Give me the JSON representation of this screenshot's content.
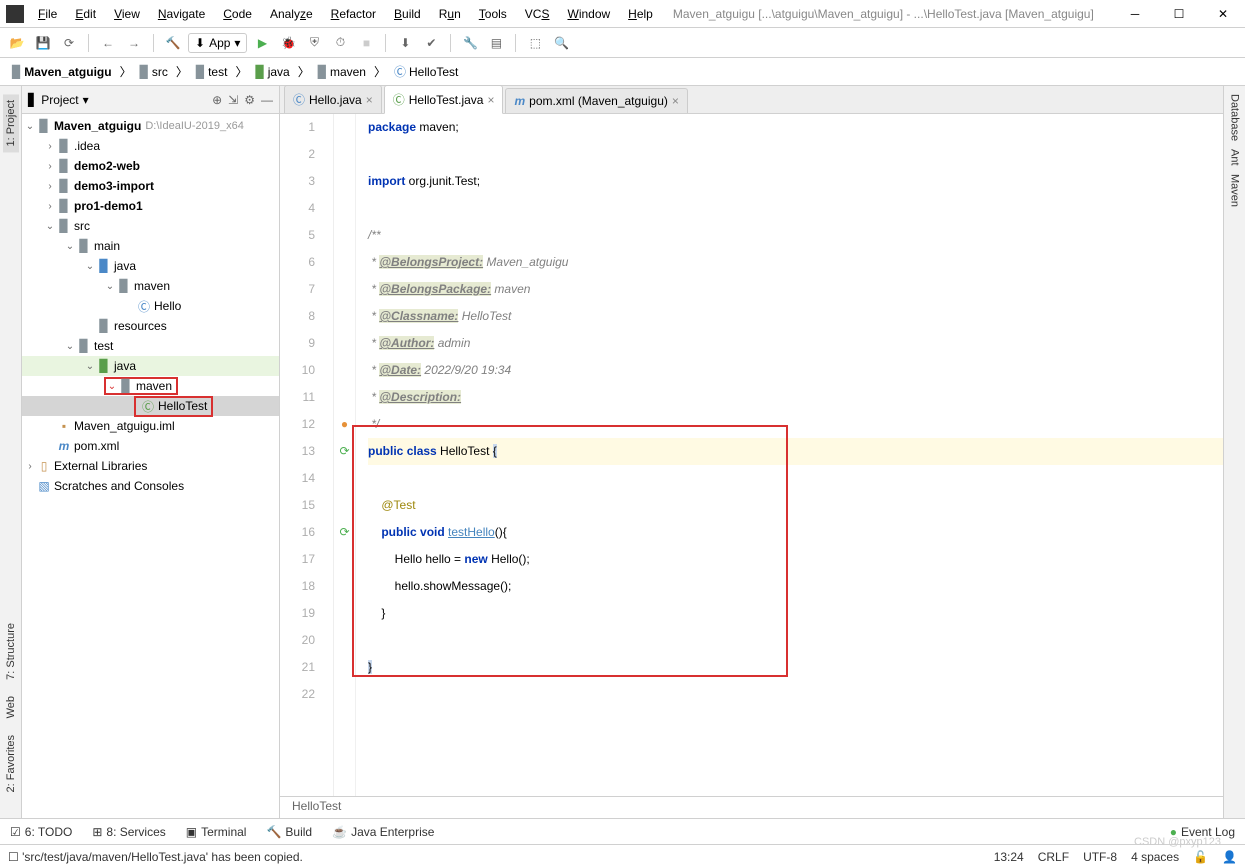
{
  "window": {
    "title": "Maven_atguigu [...\\atguigu\\Maven_atguigu] - ...\\HelloTest.java [Maven_atguigu]"
  },
  "menus": {
    "file": "File",
    "edit": "Edit",
    "view": "View",
    "navigate": "Navigate",
    "code": "Code",
    "analyze": "Analyze",
    "refactor": "Refactor",
    "build": "Build",
    "run": "Run",
    "tools": "Tools",
    "vcs": "VCS",
    "window": "Window",
    "help": "Help"
  },
  "toolbar": {
    "config": "App"
  },
  "breadcrumbs": [
    "Maven_atguigu",
    "src",
    "test",
    "java",
    "maven",
    "HelloTest"
  ],
  "panel": {
    "title": "Project"
  },
  "tree": {
    "root": {
      "name": "Maven_atguigu",
      "path": "D:\\IdeaIU-2019_x64"
    },
    "idea": ".idea",
    "demo2": "demo2-web",
    "demo3": "demo3-import",
    "pro1": "pro1-demo1",
    "src": "src",
    "main": "main",
    "main_java": "java",
    "main_maven": "maven",
    "hello": "Hello",
    "resources": "resources",
    "test": "test",
    "test_java": "java",
    "test_maven": "maven",
    "hellotest": "HelloTest",
    "iml": "Maven_atguigu.iml",
    "pom": "pom.xml",
    "extlib": "External Libraries",
    "scratches": "Scratches and Consoles"
  },
  "tabs": {
    "t0": {
      "name": "Hello.java"
    },
    "t1": {
      "name": "HelloTest.java"
    },
    "t2": {
      "name": "pom.xml (Maven_atguigu)"
    }
  },
  "code": {
    "l1": {
      "kw": "package",
      "rest": " maven;"
    },
    "l3": {
      "kw": "import",
      "rest": " org.junit.Test;"
    },
    "l5": "/**",
    "l6": {
      "tag": "@BelongsProject:",
      "val": " Maven_atguigu"
    },
    "l7": {
      "tag": "@BelongsPackage:",
      "val": " maven"
    },
    "l8": {
      "tag": "@Classname:",
      "val": " HelloTest"
    },
    "l9": {
      "tag": "@Author:",
      "val": " admin"
    },
    "l10": {
      "tag": "@Date:",
      "val": " 2022/9/20 19:34"
    },
    "l11": {
      "tag": "@Description:",
      "val": ""
    },
    "l12": "*/",
    "l13": {
      "a": "public",
      "b": "class",
      "c": " HelloTest ",
      "d": "{"
    },
    "l15": "@Test",
    "l16": {
      "a": "public",
      "b": "void",
      "c": "testHello",
      "d": "(){"
    },
    "l17": {
      "a": "Hello hello = ",
      "b": "new",
      "c": " Hello();"
    },
    "l18": "hello.showMessage();",
    "l19": "}",
    "l21": "}"
  },
  "crumb2": "HelloTest",
  "btools": {
    "todo": "6: TODO",
    "services": "8: Services",
    "terminal": "Terminal",
    "build": "Build",
    "jent": "Java Enterprise",
    "evlog": "Event Log"
  },
  "status": {
    "msg": "'src/test/java/maven/HelloTest.java' has been copied.",
    "pos": "13:24",
    "eol": "CRLF",
    "enc": "UTF-8",
    "indent": "4 spaces"
  },
  "sidetabs": {
    "project": "1: Project",
    "structure": "7: Structure",
    "web": "Web",
    "fav": "2: Favorites",
    "db": "Database",
    "ant": "Ant",
    "maven": "Maven"
  },
  "watermark": "CSDN @pxyp123"
}
